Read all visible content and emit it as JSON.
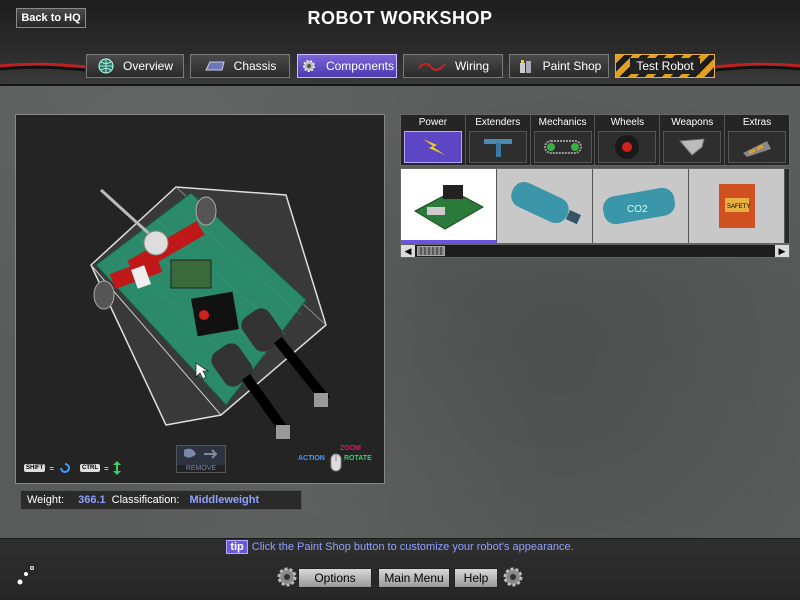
{
  "header": {
    "back_label": "Back to HQ",
    "title": "ROBOT WORKSHOP",
    "tabs": [
      {
        "label": "Overview",
        "icon": "globe-icon"
      },
      {
        "label": "Chassis",
        "icon": "chassis-icon"
      },
      {
        "label": "Components",
        "icon": "gear-icon",
        "active": true
      },
      {
        "label": "Wiring",
        "icon": "wire-icon"
      },
      {
        "label": "Paint Shop",
        "icon": "paint-icon"
      },
      {
        "label": "Test Robot",
        "icon": "hazard-stripe"
      }
    ]
  },
  "viewport": {
    "shift_key": "SHIFT",
    "ctrl_key": "CTRL",
    "remove_label": "REMOVE",
    "zoom_label": "ZOOM",
    "action_label": "ACTION",
    "rotate_label": "ROTATE"
  },
  "status": {
    "weight_label": "Weight:",
    "weight_value": "366.1",
    "class_label": "Classification:",
    "class_value": "Middleweight"
  },
  "categories": [
    {
      "label": "Power",
      "icon": "lightning-icon",
      "active": true
    },
    {
      "label": "Extenders",
      "icon": "t-bar-icon"
    },
    {
      "label": "Mechanics",
      "icon": "chain-belt-icon"
    },
    {
      "label": "Wheels",
      "icon": "wheel-icon"
    },
    {
      "label": "Weapons",
      "icon": "blade-icon"
    },
    {
      "label": "Extras",
      "icon": "wedge-icon"
    }
  ],
  "parts": [
    {
      "name": "circuit-board",
      "selected": true
    },
    {
      "name": "gas-tank",
      "text": ""
    },
    {
      "name": "co2-tank",
      "text": "CO2"
    },
    {
      "name": "safety-box",
      "text": "SAFETY"
    }
  ],
  "tip": {
    "tag": "tip",
    "text": "Click the Paint Shop button to customize your robot's appearance."
  },
  "menu": {
    "options": "Options",
    "main_menu": "Main Menu",
    "help": "Help"
  },
  "colors": {
    "accent": "#6b55e0",
    "value_text": "#8fa0ff",
    "board_green": "#2b8a6a"
  }
}
